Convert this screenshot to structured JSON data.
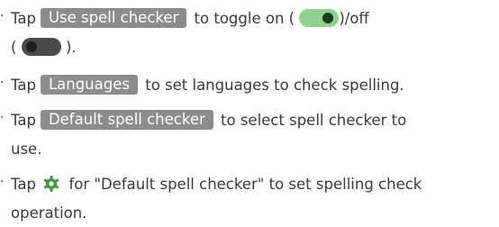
{
  "bullet_glyph": "·",
  "items": [
    {
      "pre": "Tap",
      "key": "Use spell checker",
      "post1": "to toggle on (",
      "post2": ")/off",
      "cont_pre": "(",
      "cont_post": ")."
    },
    {
      "pre": "Tap",
      "key": "Languages",
      "post": "to set languages to check spelling."
    },
    {
      "pre": "Tap",
      "key": "Default spell checker",
      "post": "to select spell checker to",
      "cont": "use."
    },
    {
      "pre": "Tap",
      "post": "for \"Default spell checker\" to set spelling check",
      "cont": "operation."
    }
  ],
  "icons": {
    "toggle_on": "toggle-on-icon",
    "toggle_off": "toggle-off-icon",
    "gear": "gear-icon"
  },
  "colors": {
    "text": "#3a3a3a",
    "key_bg": "#8c8c8c",
    "toggle_on": "#8fd18f",
    "toggle_off": "#4a4a4a",
    "gear": "#3f9a3f"
  }
}
